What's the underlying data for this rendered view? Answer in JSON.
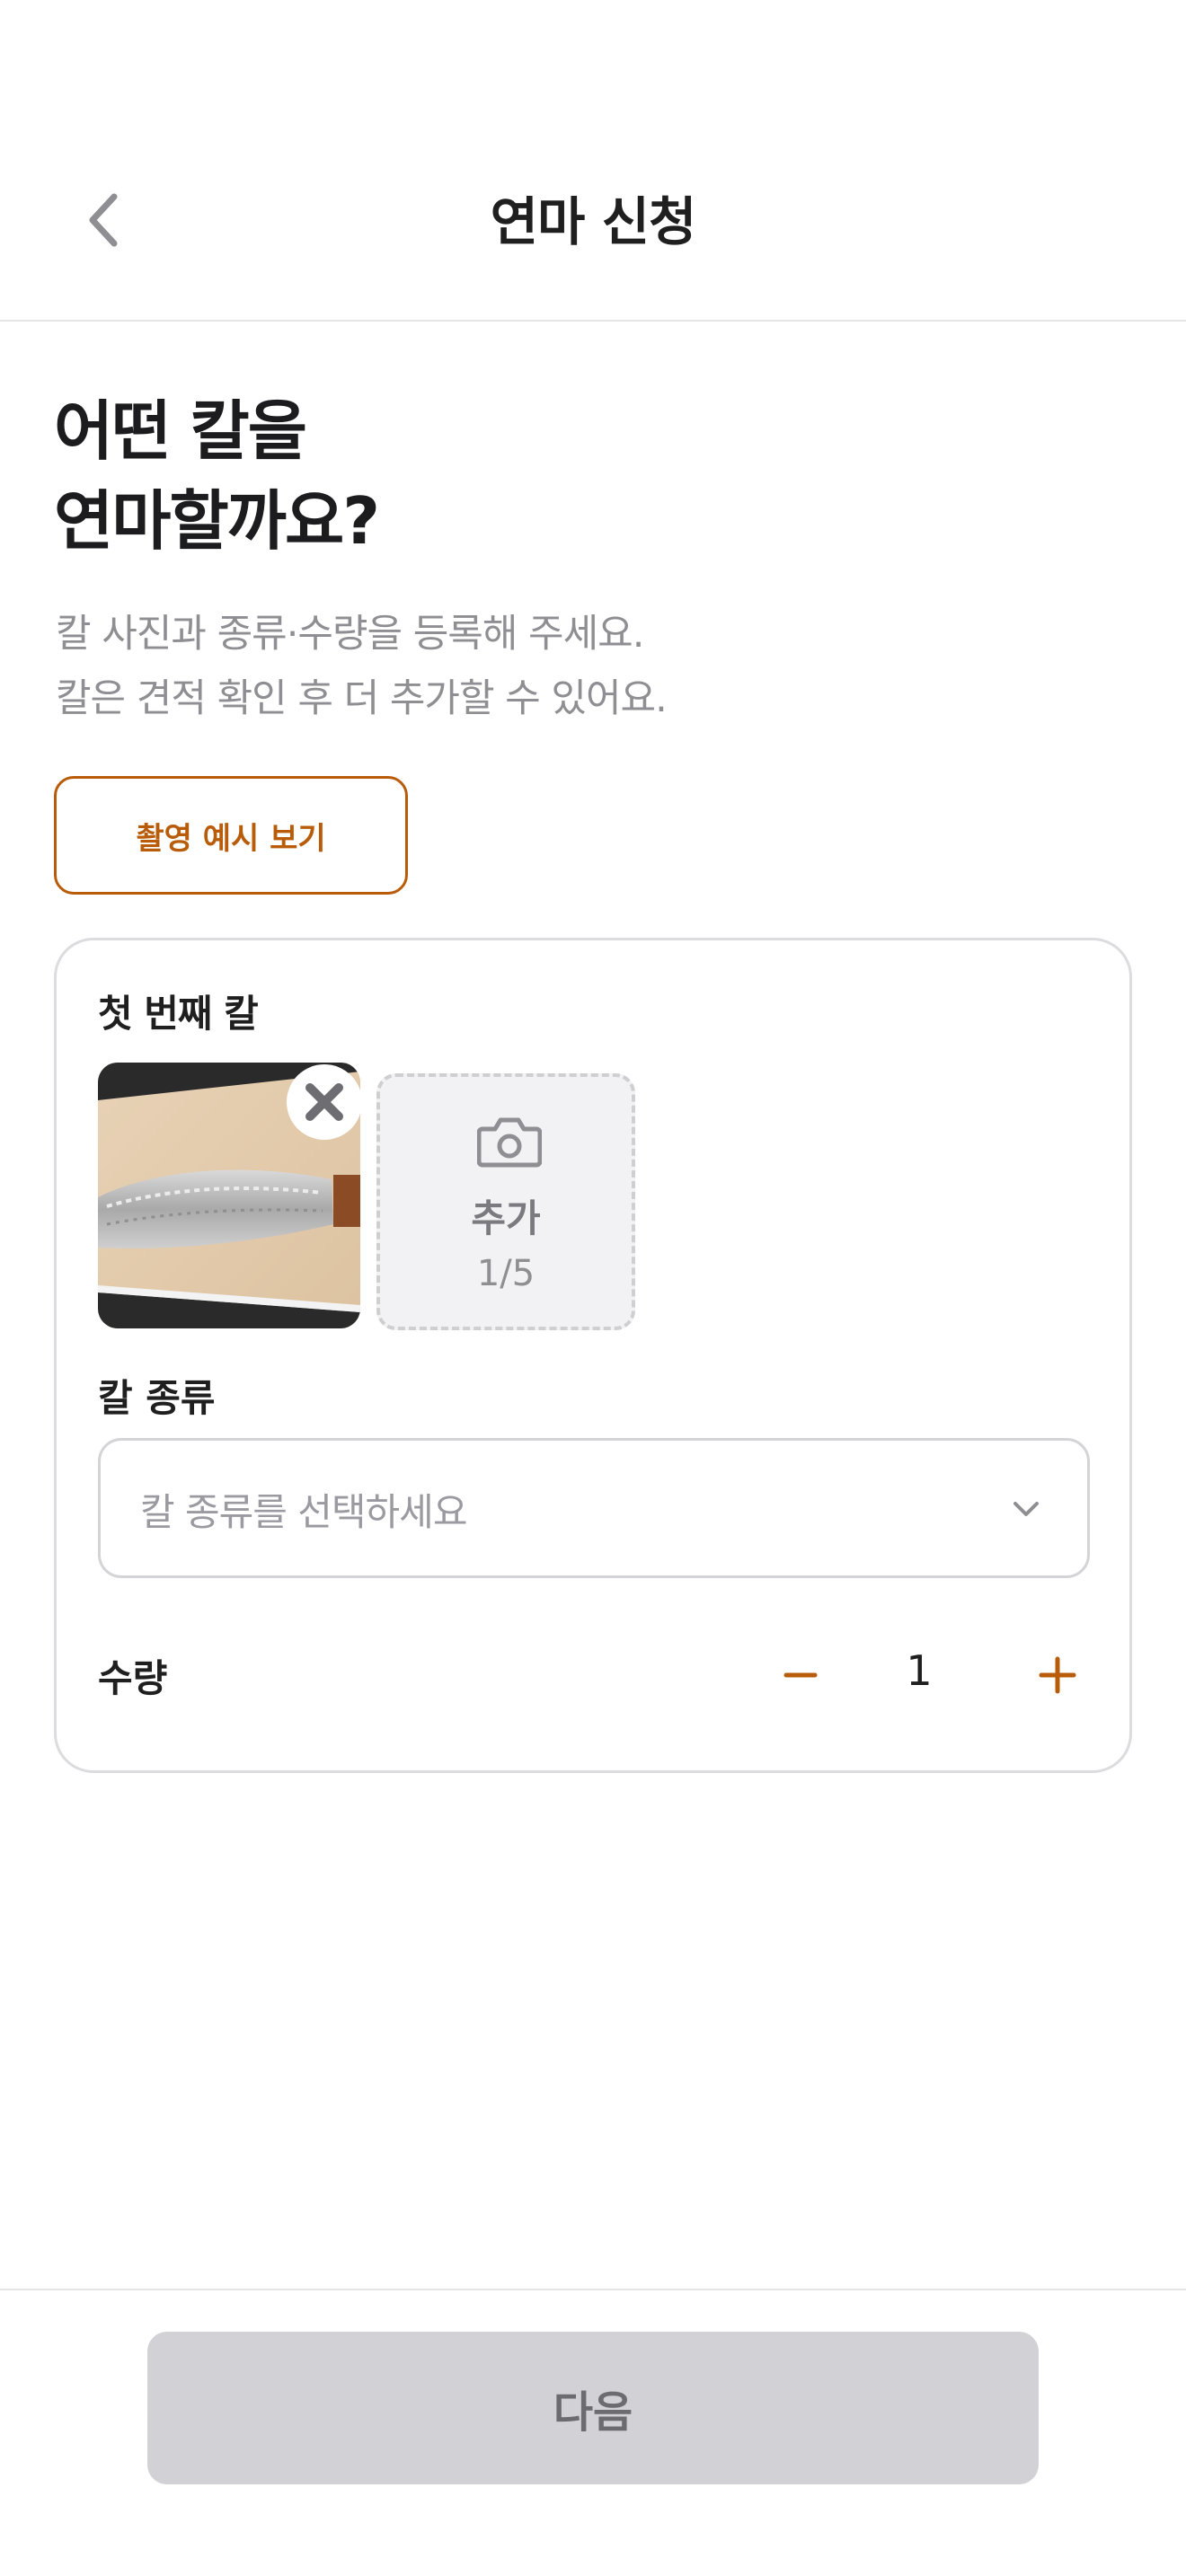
{
  "header": {
    "title": "연마 신청",
    "back_icon": "chevron-left-icon"
  },
  "intro": {
    "heading_lines": [
      "어떤 칼을",
      "연마할까요?"
    ],
    "description_lines": [
      "칼 사진과 종류·수량을 등록해 주세요.",
      "칼은 견적 확인 후 더 추가할 수 있어요."
    ],
    "example_button_label": "촬영 예시 보기"
  },
  "knife_card": {
    "title": "첫 번째 칼",
    "photo": {
      "alt": "knife photo",
      "remove_icon": "close-icon"
    },
    "add_photo": {
      "icon": "camera-icon",
      "label": "추가",
      "count": "1/5"
    },
    "type_field": {
      "label": "칼 종류",
      "placeholder": "칼 종류를 선택하세요",
      "chevron_icon": "chevron-down-icon"
    },
    "quantity": {
      "label": "수량",
      "value": "1",
      "minus_icon": "minus-icon",
      "plus_icon": "plus-icon"
    }
  },
  "footer": {
    "next_label": "다음",
    "next_enabled": false
  },
  "colors": {
    "accent": "#b85c0a",
    "disabled_button": "#d1d1d6",
    "text_primary": "#1f1f1f",
    "text_secondary": "#8e8e93"
  }
}
